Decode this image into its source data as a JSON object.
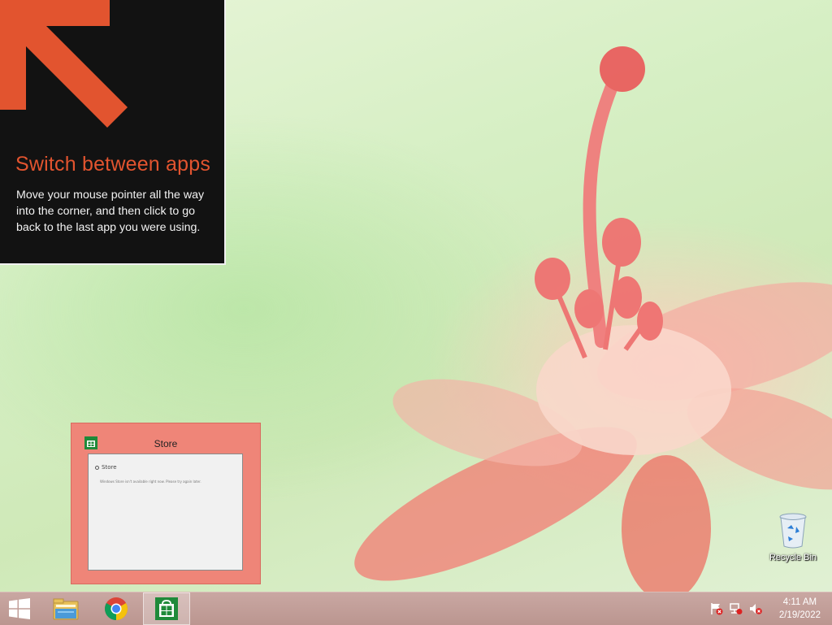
{
  "tip": {
    "title": "Switch between apps",
    "body": "Move your mouse pointer all the way into the corner, and then click to go back to the last app you were using."
  },
  "thumbnail": {
    "title": "Store",
    "preview_header": "Store",
    "preview_message": "Windows Store isn't available right now. Please try again later."
  },
  "desktop": {
    "recycle_bin_label": "Recycle Bin"
  },
  "taskbar": {
    "items": [
      {
        "name": "start",
        "icon": "windows-logo"
      },
      {
        "name": "file-explorer",
        "icon": "folder-icon"
      },
      {
        "name": "chrome",
        "icon": "chrome-icon"
      },
      {
        "name": "store",
        "icon": "store-icon",
        "active": true
      }
    ],
    "tray": {
      "time": "4:11 AM",
      "date": "2/19/2022",
      "icons": [
        "action-center-flag-icon",
        "network-icon",
        "volume-muted-icon"
      ]
    }
  },
  "colors": {
    "accent_orange": "#e2542f",
    "thumbnail_bg": "#ef8578",
    "taskbar": "#c9a7a2"
  }
}
